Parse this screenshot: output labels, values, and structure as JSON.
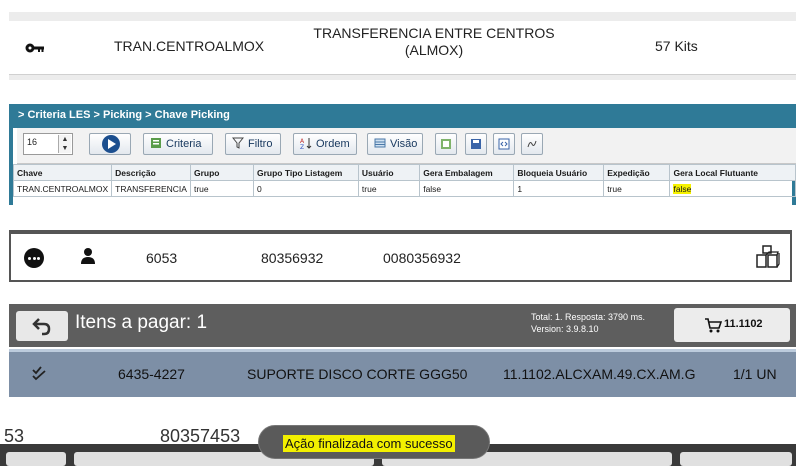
{
  "kit_row": {
    "chave": "TRAN.CENTROALMOX",
    "descricao": "TRANSFERENCIA ENTRE CENTROS (ALMOX)",
    "quantidade": "57 Kits"
  },
  "les": {
    "breadcrumb": "> Criteria LES > Picking > Chave Picking",
    "page_size": "16",
    "toolbar": {
      "criteria": "Criteria",
      "filtro": "Filtro",
      "ordem": "Ordem",
      "visao": "Visão"
    },
    "columns": [
      "Chave",
      "Descrição",
      "Grupo",
      "Grupo Tipo Listagem",
      "Usuário",
      "Gera Embalagem",
      "Bloqueia Usuário",
      "Expedição",
      "Gera Local Flutuante"
    ],
    "row": [
      "TRAN.CENTROALMOX",
      "TRANSFERENCIA",
      "true",
      "0",
      "true",
      "false",
      "1",
      "true",
      "false"
    ],
    "highlight_color": "#f6f200",
    "header_color": "#2f7a97"
  },
  "picking_row": {
    "codigo": "6053",
    "numero": "80356932",
    "documento": "0080356932"
  },
  "pagar": {
    "title": "Itens a pagar: 1",
    "total": "Total: 1. Resposta: 3790 ms.",
    "version": "Version: 3.9.8.10",
    "cart_label": "11.1102",
    "item": {
      "codigo": "6435-4227",
      "descricao": "SUPORTE DISCO CORTE GGG50",
      "local": "11.1102.ALCXAM.49.CX.AM.G",
      "qtd": "1/1 UN"
    },
    "row_color": "#7d8fa6"
  },
  "toast_panel": {
    "left_num": "53",
    "mid_num": "80357453",
    "message": "Ação finalizada com sucesso"
  }
}
